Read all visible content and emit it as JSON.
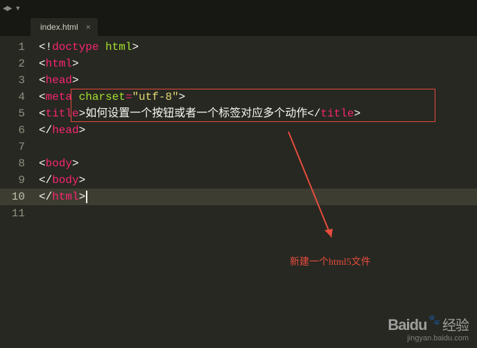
{
  "tab": {
    "filename": "index.html",
    "close": "×"
  },
  "gutter": [
    "1",
    "2",
    "3",
    "4",
    "5",
    "6",
    "7",
    "8",
    "9",
    "10",
    "11"
  ],
  "code": {
    "l1": {
      "a": "<!",
      "b": "doctype",
      "c": " ",
      "d": "html",
      "e": ">"
    },
    "l2": {
      "a": "<",
      "b": "html",
      "c": ">"
    },
    "l3": {
      "a": "<",
      "b": "head",
      "c": ">"
    },
    "l4": {
      "a": "<",
      "b": "meta",
      "c": " ",
      "d": "charset",
      "e": "=",
      "f": "\"utf-8\"",
      "g": ">"
    },
    "l5": {
      "a": "<",
      "b": "title",
      "c": ">",
      "d": "如何设置一个按钮或者一个标签对应多个动作",
      "e": "</",
      "f": "title",
      "g": ">"
    },
    "l6": {
      "a": "</",
      "b": "head",
      "c": ">"
    },
    "l8": {
      "a": "<",
      "b": "body",
      "c": ">"
    },
    "l9": {
      "a": "</",
      "b": "body",
      "c": ">"
    },
    "l10": {
      "a": "</",
      "b": "html",
      "c": ">"
    }
  },
  "annotation": "新建一个html5文件",
  "watermark": {
    "brand": "Bai",
    "brand2": "du",
    "cn": "经验",
    "url": "jingyan.baidu.com"
  }
}
